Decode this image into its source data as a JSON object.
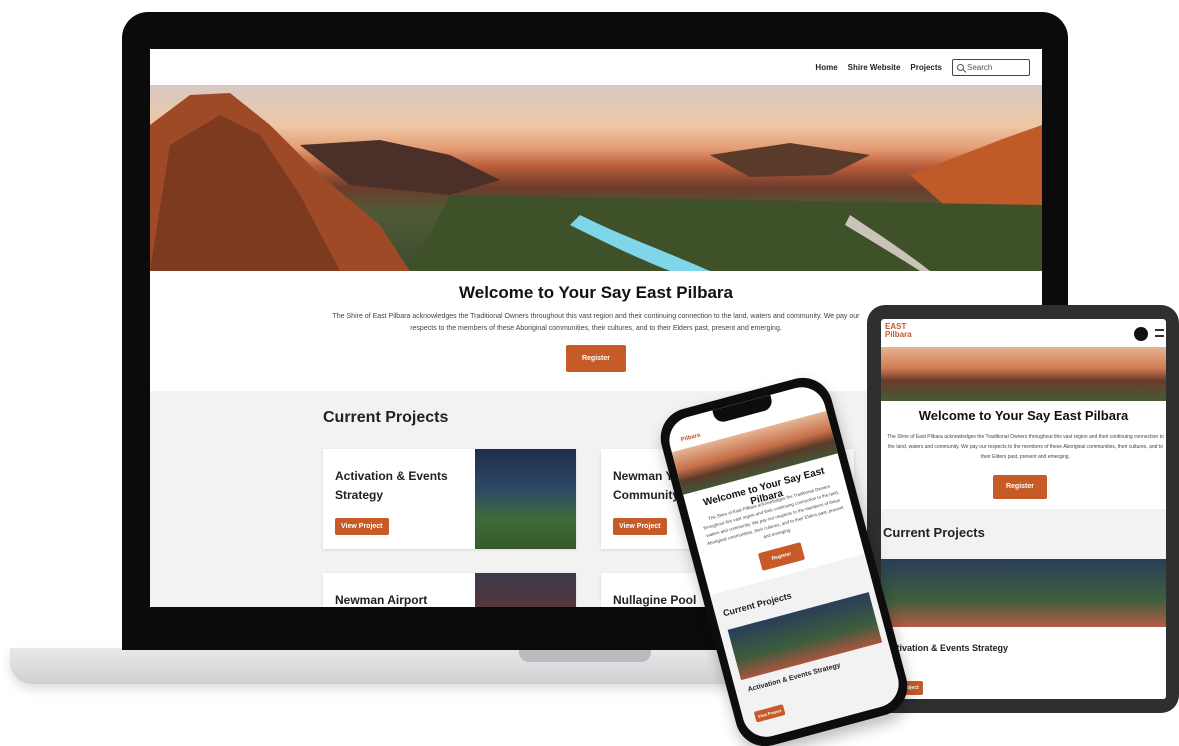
{
  "nav": {
    "items": [
      "Home",
      "Shire Website",
      "Projects"
    ],
    "search_placeholder": "Search"
  },
  "welcome": {
    "title": "Welcome to Your Say East Pilbara",
    "text": "The Shire of East Pilbara acknowledges the Traditional Owners throughout this vast region and their continuing connection to the land, waters and community. We pay our respects to the members of these Aboriginal communities, their cultures, and to their Elders past, present and emerging.",
    "register_label": "Register"
  },
  "projects": {
    "heading": "Current Projects",
    "view_label": "View Project",
    "items": [
      {
        "title": "Activation & Events Strategy"
      },
      {
        "title": "Newman Youth & Community Hub"
      },
      {
        "title": "Newman Airport"
      },
      {
        "title": "Nullagine Pool"
      }
    ]
  },
  "mobile": {
    "logo_line1": "EAST",
    "logo_line2": "Pilbara"
  },
  "colors": {
    "accent": "#c65b28",
    "section_bg": "#f2f2f2"
  }
}
